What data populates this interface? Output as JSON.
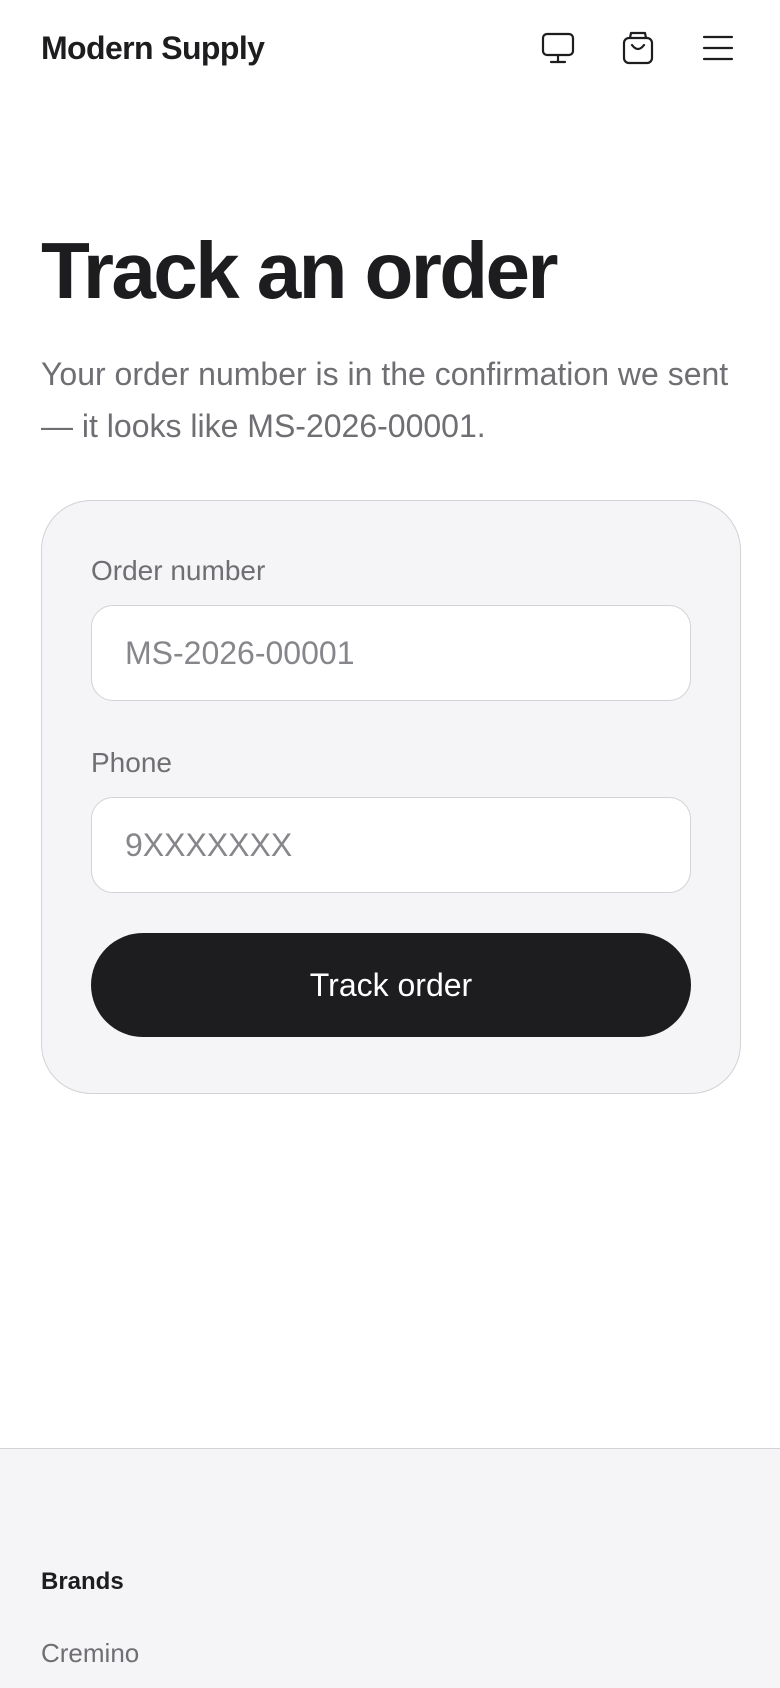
{
  "header": {
    "brand": "Modern Supply",
    "icons": [
      "monitor-icon",
      "shopping-bag-icon",
      "menu-icon"
    ]
  },
  "main": {
    "title": "Track an order",
    "subtitle": "Your order number is in the confirmation we sent — it looks like MS-2026-00001."
  },
  "form": {
    "order_number_label": "Order number",
    "order_number_placeholder": "MS-2026-00001",
    "order_number_value": "",
    "phone_label": "Phone",
    "phone_placeholder": "9XXXXXXX",
    "phone_value": "",
    "submit_label": "Track order"
  },
  "footer": {
    "heading": "Brands",
    "links": [
      "Cremino"
    ]
  },
  "colors": {
    "text": "#1d1d1f",
    "muted": "#6e6e73",
    "placeholder": "#86868b",
    "surface": "#f5f5f7",
    "border": "#d2d2d7",
    "button": "#1d1d1f"
  }
}
